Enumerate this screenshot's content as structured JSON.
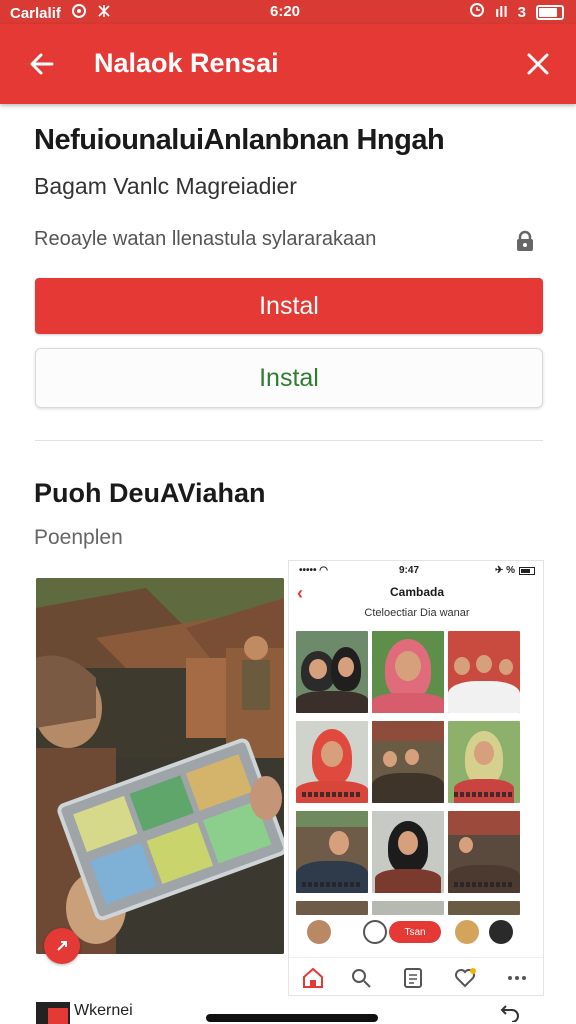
{
  "status_bar": {
    "carrier": "Carlalif",
    "time": "6:20",
    "signal": "ıll",
    "network": "3",
    "battery_percent": 80
  },
  "app_bar": {
    "title": "Nalaok Rensai",
    "back_icon": "arrow-left-icon",
    "close_icon": "close-icon"
  },
  "app": {
    "name": "NefuiounaluiAnlanbnan Hngah",
    "developer": "Bagam Vanlc Magreiadier",
    "contains_text": "Reoayle watan llenastula sylararakaan",
    "lock_icon": "lock-icon"
  },
  "buttons": {
    "primary_label": "Instal",
    "secondary_label": "Instal"
  },
  "section": {
    "title": "Puoh DeuAViahan",
    "subtitle": "Poenplen"
  },
  "screenshot_phone": {
    "carrier": "••••• ◠",
    "time": "9:47",
    "battery": "✈ %",
    "title": "Cambada",
    "subtitle": "Cteloectiar Dia wanar",
    "pill_label": "Tsan"
  },
  "bottom": {
    "label": "Wkernei"
  },
  "colors": {
    "accent": "#e53935",
    "install_green": "#2e7d32"
  }
}
